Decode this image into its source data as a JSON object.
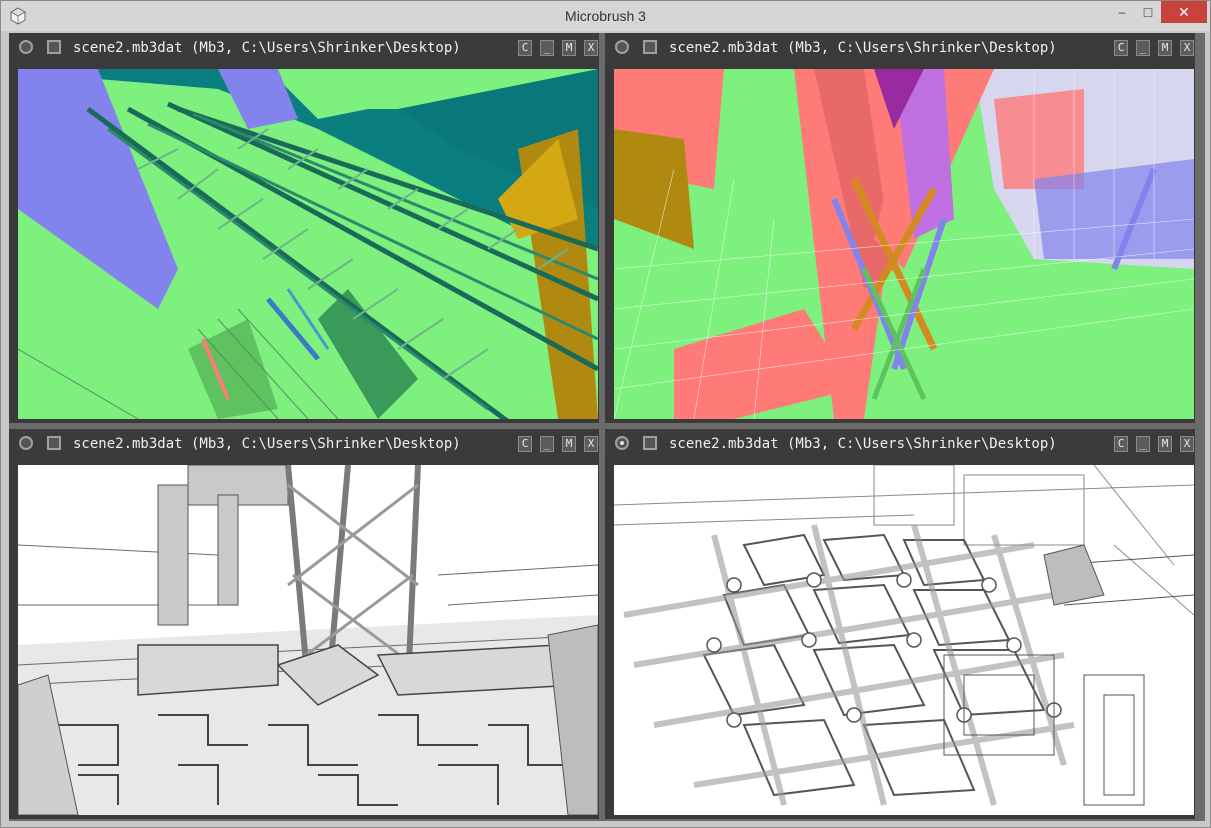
{
  "window": {
    "title": "Microbrush 3",
    "controls": {
      "minimize": "–",
      "maximize": "□",
      "close": "✕"
    }
  },
  "panes": [
    {
      "title": "scene2.mb3dat (Mb3, C:\\Users\\Shrinker\\Desktop)",
      "active": false,
      "buttons": {
        "c": "C",
        "min": "_",
        "max": "M",
        "close": "X"
      },
      "render": "normals-color"
    },
    {
      "title": "scene2.mb3dat (Mb3, C:\\Users\\Shrinker\\Desktop)",
      "active": false,
      "buttons": {
        "c": "C",
        "min": "_",
        "max": "M",
        "close": "X"
      },
      "render": "normals-color-wire"
    },
    {
      "title": "scene2.mb3dat (Mb3, C:\\Users\\Shrinker\\Desktop)",
      "active": false,
      "buttons": {
        "c": "C",
        "min": "_",
        "max": "M",
        "close": "X"
      },
      "render": "grayscale"
    },
    {
      "title": "scene2.mb3dat (Mb3, C:\\Users\\Shrinker\\Desktop)",
      "active": true,
      "buttons": {
        "c": "C",
        "min": "_",
        "max": "M",
        "close": "X"
      },
      "render": "grayscale-outline"
    }
  ],
  "colors": {
    "titlebar": "#d6d6d6",
    "close_button": "#c7433b",
    "pane_bar": "#3b3b3b",
    "teal": "#0b7f7f",
    "green": "#7ef07e",
    "violet": "#8383ee",
    "salmon": "#ff7b78"
  }
}
